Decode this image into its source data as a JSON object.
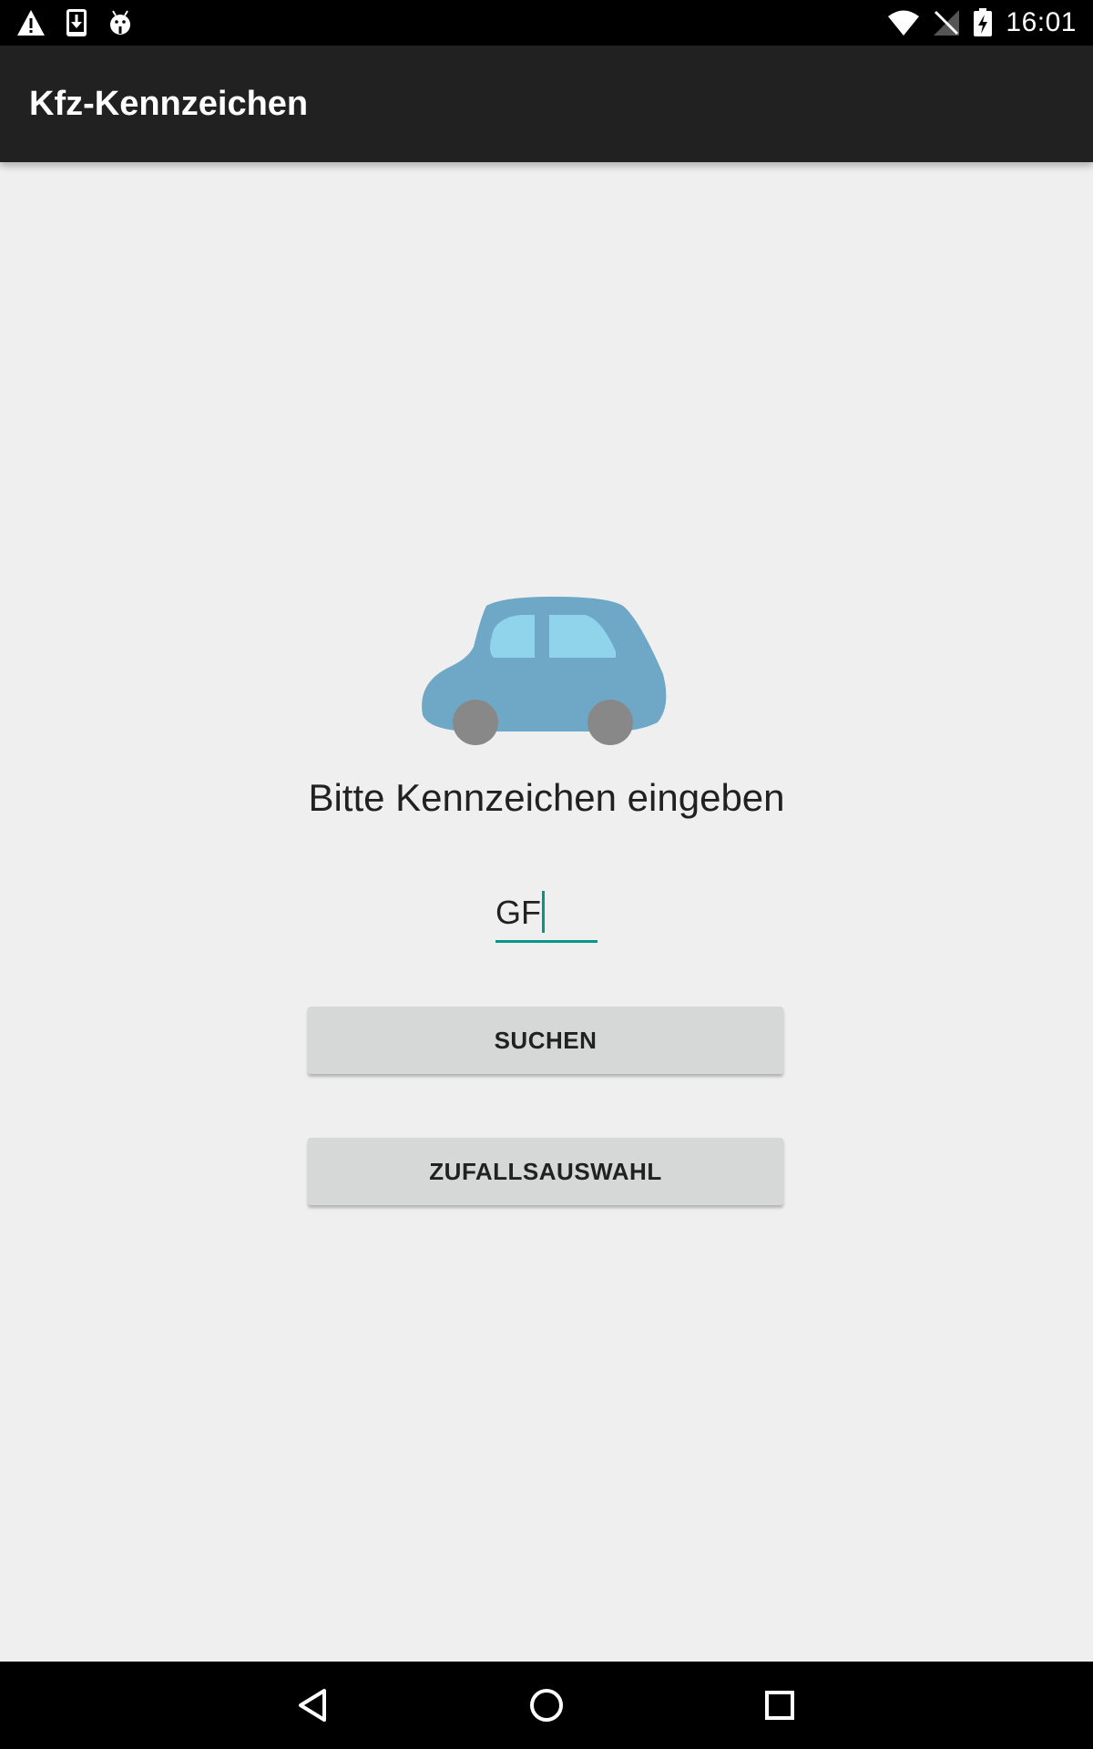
{
  "status_bar": {
    "time": "16:01",
    "left_icons": [
      "warning-icon",
      "download-icon",
      "android-debug-icon"
    ],
    "right_icons": [
      "wifi-icon",
      "no-signal-icon",
      "battery-charging-icon"
    ]
  },
  "app_bar": {
    "title": "Kfz-Kennzeichen"
  },
  "main": {
    "image_icon": "car-icon",
    "prompt": "Bitte Kennzeichen eingeben",
    "plate_input_value": "GF",
    "search_button_label": "SUCHEN",
    "random_button_label": "ZUFALLSAUSWAHL"
  },
  "nav_bar": {
    "icons": [
      "back-icon",
      "home-icon",
      "recent-apps-icon"
    ]
  },
  "colors": {
    "accent": "#009688",
    "app_bar": "#212121",
    "background": "#efefef",
    "car_body": "#6fa8c7",
    "car_window": "#8fd4ea",
    "car_wheel": "#888888"
  }
}
